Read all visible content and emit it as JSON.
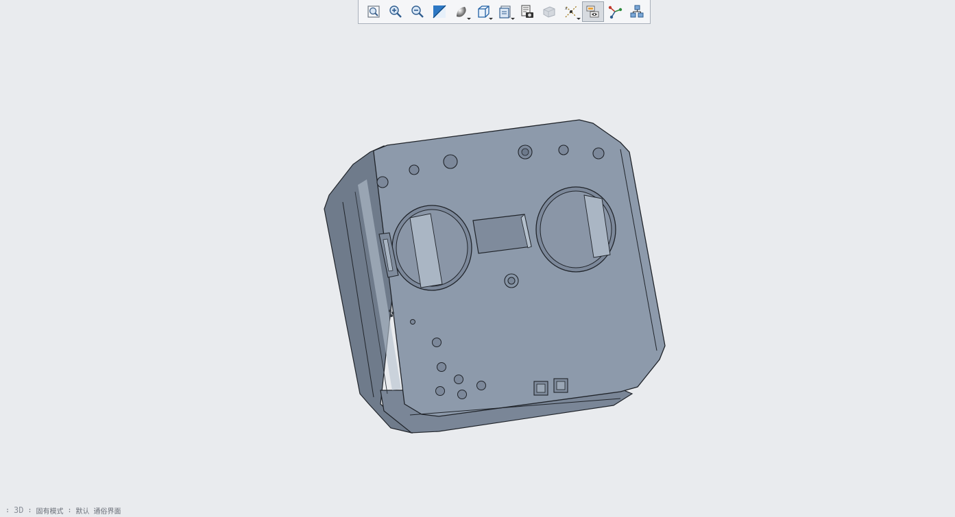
{
  "toolbar": {
    "buttons": [
      {
        "name": "refit-button",
        "icon": "refit-icon"
      },
      {
        "name": "zoom-in-button",
        "icon": "zoom-in-icon"
      },
      {
        "name": "zoom-out-button",
        "icon": "zoom-out-icon"
      },
      {
        "name": "repaint-button",
        "icon": "repaint-icon"
      },
      {
        "name": "display-style-button",
        "icon": "display-style-icon"
      },
      {
        "name": "saved-orientations-button",
        "icon": "cube-view-icon"
      },
      {
        "name": "view-manager-button",
        "icon": "view-manager-icon"
      },
      {
        "name": "snapshot-button",
        "icon": "camera-icon"
      },
      {
        "name": "perspective-button",
        "icon": "perspective-icon"
      },
      {
        "name": "datum-display-button",
        "icon": "datum-display-icon"
      },
      {
        "name": "annotation-display-button",
        "icon": "annotation-display-icon",
        "active": true
      },
      {
        "name": "spin-center-button",
        "icon": "spin-center-icon"
      },
      {
        "name": "model-tree-button",
        "icon": "model-tree-icon"
      }
    ]
  },
  "colors": {
    "background": "#e9ebee",
    "model_face": "#8d9aab",
    "model_edge": "#1f2329",
    "model_side": "#6f7b8b"
  },
  "statusbar": {
    "prefix": ":",
    "mode": "3D",
    "sep1": ":",
    "item1": "固有模式",
    "sep2": ":",
    "item2": "默认",
    "item3": "通俗界面"
  }
}
